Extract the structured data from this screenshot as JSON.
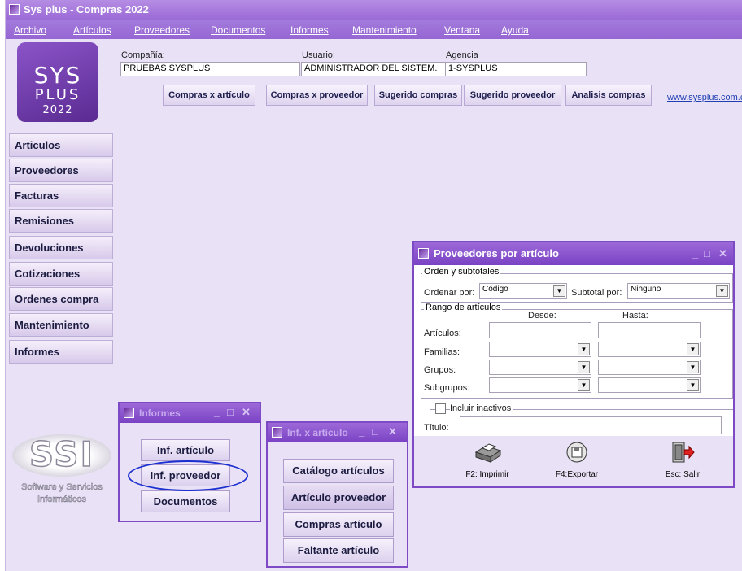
{
  "window": {
    "title": "Sys plus - Compras 2022"
  },
  "menu": [
    "Archivo",
    "Artículos",
    "Proveedores",
    "Documentos",
    "Informes",
    "Mantenimiento",
    "Ventana",
    "Ayuda"
  ],
  "logo": {
    "line1": "SYS",
    "line2": "PLUS",
    "line3": "2022"
  },
  "header": {
    "company_label": "Compañía:",
    "company_value": "PRUEBAS SYSPLUS",
    "user_label": "Usuario:",
    "user_value": "ADMINISTRADOR DEL SISTEM.",
    "agency_label": "Agencia",
    "agency_value": "1-SYSPLUS"
  },
  "toolbar": [
    "Compras x artículo",
    "Compras x proveedor",
    "Sugerido compras",
    "Sugerido proveedor",
    "Analisis compras"
  ],
  "website": "www.sysplus.com.c",
  "sidebar": [
    "Articulos",
    "Proveedores",
    "Facturas",
    "Remisiones",
    "Devoluciones",
    "Cotizaciones",
    "Ordenes compra",
    "Mantenimiento",
    "Informes"
  ],
  "ssi": {
    "logo": "SSI",
    "line1": "Software y Servicios",
    "line2": "Informáticos"
  },
  "informes_window": {
    "title": "Informes",
    "buttons": [
      "Inf. artículo",
      "Inf. proveedor",
      "Documentos"
    ]
  },
  "infart_window": {
    "title": "Inf. x artículo",
    "buttons": [
      "Catálogo artículos",
      "Artículo proveedor",
      "Compras artículo",
      "Faltante artículo"
    ]
  },
  "prov_window": {
    "title": "Proveedores por artículo",
    "orden_group": "Orden y subtotales",
    "ordenar_label": "Ordenar por:",
    "ordenar_value": "Código",
    "subtotal_label": "Subtotal por:",
    "subtotal_value": "Ninguno",
    "rango_group": "Rango de artículos",
    "desde": "Desde:",
    "hasta": "Hasta:",
    "rows": [
      "Artículos:",
      "Familias:",
      "Grupos:",
      "Subgrupos:"
    ],
    "incluir": "Incluir inactivos",
    "titulo_label": "Título:",
    "actions": [
      "F2: Imprimir",
      "F4:Exportar",
      "Esc: Salir"
    ]
  },
  "colors": {
    "accent": "#9666d3",
    "title_bar": "#7a42c4",
    "highlight_ellipse": "#1a2ed1",
    "link": "#1f3fb3"
  }
}
